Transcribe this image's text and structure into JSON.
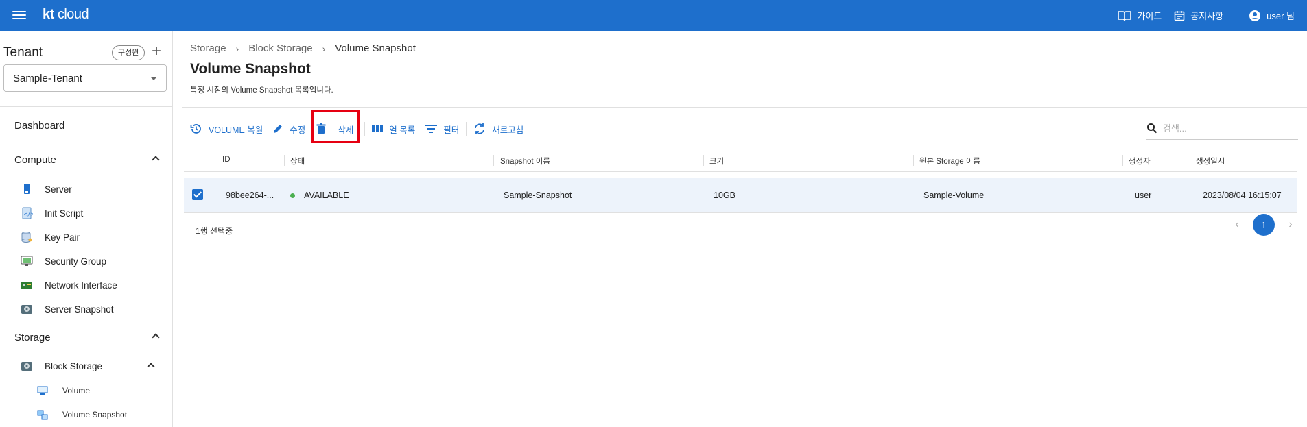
{
  "header": {
    "logo_kt": "kt",
    "logo_cloud": "cloud",
    "guide": "가이드",
    "notice": "공지사항",
    "user": "user 님"
  },
  "sidebar": {
    "tenant_title": "Tenant",
    "member_chip": "구성원",
    "tenant_selected": "Sample-Tenant",
    "dashboard": "Dashboard",
    "compute": {
      "label": "Compute",
      "items": [
        {
          "label": "Server",
          "icon": "server-icon"
        },
        {
          "label": "Init Script",
          "icon": "script-icon"
        },
        {
          "label": "Key Pair",
          "icon": "key-pair-icon"
        },
        {
          "label": "Security Group",
          "icon": "security-group-icon"
        },
        {
          "label": "Network Interface",
          "icon": "network-interface-icon"
        },
        {
          "label": "Server Snapshot",
          "icon": "server-snapshot-icon"
        }
      ]
    },
    "storage": {
      "label": "Storage",
      "block_storage": "Block Storage",
      "sub_items": [
        {
          "label": "Volume",
          "icon": "volume-icon"
        },
        {
          "label": "Volume Snapshot",
          "icon": "volume-snapshot-icon"
        }
      ]
    }
  },
  "breadcrumb": [
    "Storage",
    "Block Storage",
    "Volume Snapshot"
  ],
  "page": {
    "title": "Volume Snapshot",
    "description": "특정 시점의 Volume Snapshot 목록입니다."
  },
  "toolbar": {
    "restore": "VOLUME 복원",
    "edit": "수정",
    "delete": "삭제",
    "columns": "열 목록",
    "filter": "필터",
    "refresh": "새로고침"
  },
  "search": {
    "placeholder": "검색..."
  },
  "table": {
    "headers": [
      "ID",
      "상태",
      "Snapshot 이름",
      "크기",
      "원본 Storage 이름",
      "생성자",
      "생성일시"
    ],
    "rows": [
      {
        "id": "98bee264-...",
        "status": "AVAILABLE",
        "name": "Sample-Snapshot",
        "size": "10GB",
        "source": "Sample-Volume",
        "creator": "user",
        "created": "2023/08/04 16:15:07",
        "selected": true
      }
    ]
  },
  "footer": {
    "selected_text": "1행 선택중"
  },
  "pagination": {
    "current": "1"
  },
  "colors": {
    "accent": "#1e6fcc",
    "highlight": "#e60012",
    "status_available": "#4caf50"
  }
}
